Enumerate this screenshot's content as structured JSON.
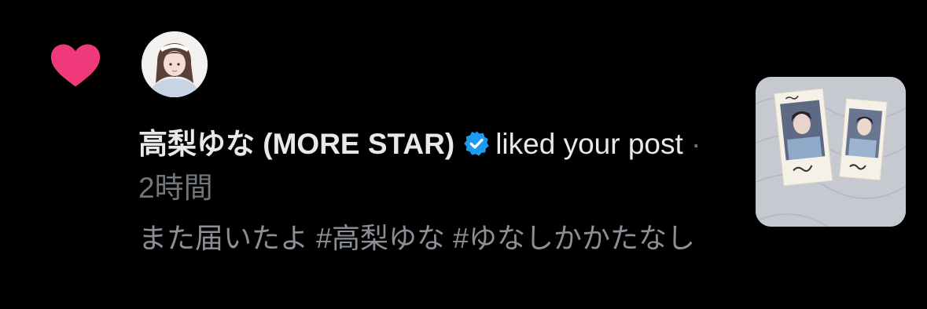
{
  "notification": {
    "type_icon": "heart-icon",
    "heart_color": "#f0397a",
    "user": {
      "name": "高梨ゆな (MORE STAR)",
      "verified": true,
      "verified_color": "#1d9bf0",
      "avatar_icon": "user-avatar"
    },
    "action_text": "liked your post",
    "separator": "·",
    "time": "2時間",
    "post_text": "また届いたよ #高梨ゆな #ゆなしかかたなし",
    "thumbnail_icon": "post-thumbnail-photo"
  }
}
